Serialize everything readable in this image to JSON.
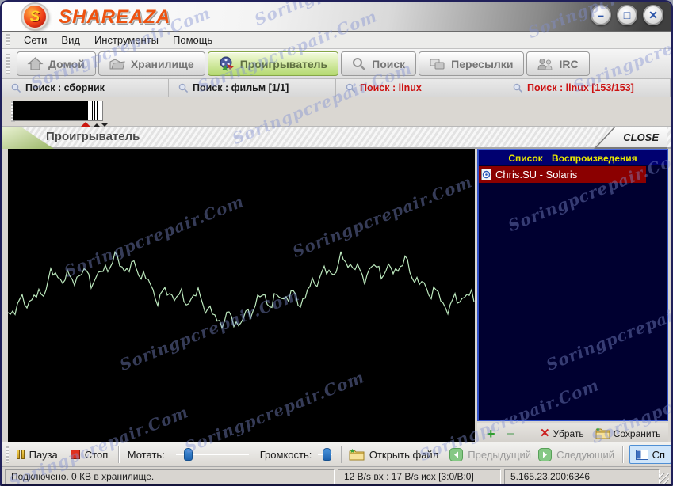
{
  "window": {
    "brand": "SHAREAZA",
    "logo_letter": "S",
    "controls": {
      "minimize": "–",
      "maximize": "□",
      "close": "✕"
    }
  },
  "menu": {
    "items": [
      "Сети",
      "Вид",
      "Инструменты",
      "Помощь"
    ]
  },
  "nav_tabs": [
    {
      "label": "Домой",
      "active": false
    },
    {
      "label": "Хранилище",
      "active": false
    },
    {
      "label": "Проигрыватель",
      "active": true
    },
    {
      "label": "Поиск",
      "active": false
    },
    {
      "label": "Пересылки",
      "active": false
    },
    {
      "label": "IRC",
      "active": false
    }
  ],
  "search_tabs": [
    {
      "label": "Поиск : сборник",
      "state": "normal"
    },
    {
      "label": "Поиск : фильм [1/1]",
      "state": "normal"
    },
    {
      "label": "Поиск : linux",
      "state": "alert"
    },
    {
      "label": "Поиск : linux [153/153]",
      "state": "alert"
    }
  ],
  "player_panel": {
    "title": "Проигрыватель",
    "close_label": "CLOSE"
  },
  "playlist": {
    "header": "Список Воспроизведения",
    "items": [
      {
        "title": "Chris.SU - Solaris",
        "selected": true
      }
    ],
    "toolbar": {
      "add": "+",
      "remove_track": "−",
      "remove_x": "✕",
      "remove_label": "Убрать",
      "save_label": "Сохранить"
    }
  },
  "controls": {
    "pause_label": "Пауза",
    "stop_label": "Стоп",
    "seek_label": "Мотать:",
    "seek_pct": 17,
    "volume_label": "Громкость:",
    "volume_pct": 62,
    "open_label": "Открыть файл",
    "prev_label": "Предыдущий",
    "next_label": "Следующий",
    "playlist_toggle_label": "Сп"
  },
  "status_bar": {
    "connection": "Подключено. 0 КВ в хранилище.",
    "bandwidth": "12 B/s вх : 17 B/s исх [3:0/B:0]",
    "address": "5.165.23.200:6346"
  },
  "watermark": {
    "text": "Soringpcrepair.Com"
  },
  "visualization": {
    "stroke_color": "#bce8bd",
    "background": "#000000"
  },
  "colors": {
    "active_tab_green": "#b4d970",
    "selected_row_red": "#8b0000",
    "playlist_bg": "#000030",
    "playlist_header_bg": "#000070",
    "playlist_header_text": "#e8e800",
    "alert_red": "#cc1111",
    "brand_orange": "#ee5210"
  }
}
